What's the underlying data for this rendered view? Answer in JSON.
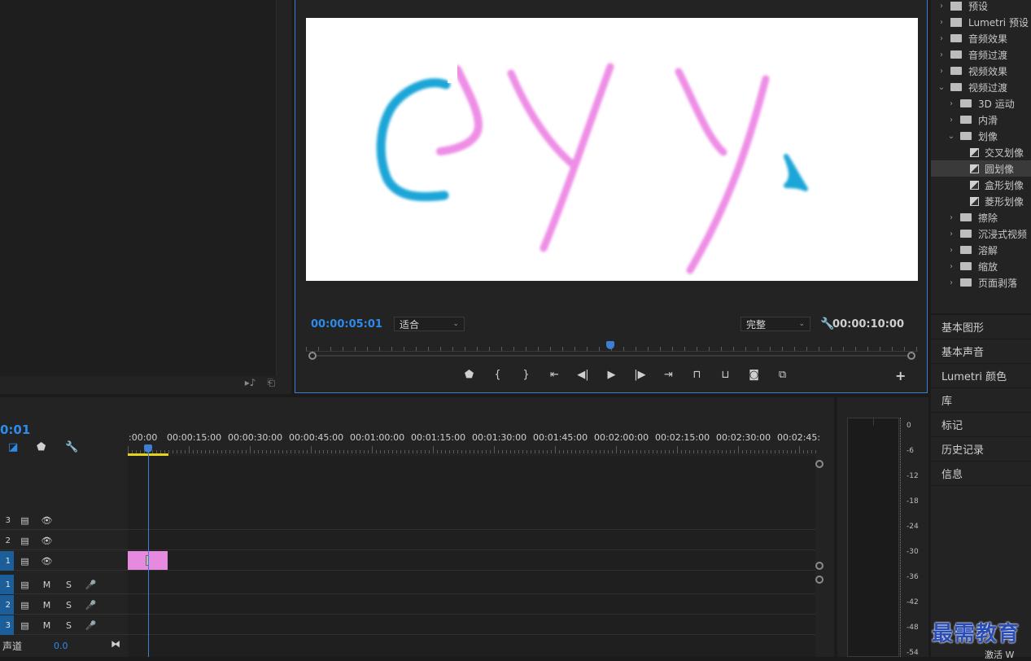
{
  "program": {
    "current_timecode": "00:00:05:01",
    "duration_timecode": "00:00:10:00",
    "fit_select": "适合",
    "quality_select": "完整"
  },
  "effects": {
    "items": [
      {
        "label": "预设",
        "depth": 0,
        "expanded": false,
        "icon": "preset-folder-icon"
      },
      {
        "label": "Lumetri 预设",
        "depth": 0,
        "expanded": false,
        "icon": "preset-folder-icon"
      },
      {
        "label": "音频效果",
        "depth": 0,
        "expanded": false,
        "icon": "folder-icon"
      },
      {
        "label": "音频过渡",
        "depth": 0,
        "expanded": false,
        "icon": "folder-icon"
      },
      {
        "label": "视频效果",
        "depth": 0,
        "expanded": false,
        "icon": "folder-icon"
      },
      {
        "label": "视频过渡",
        "depth": 0,
        "expanded": true,
        "icon": "folder-icon"
      },
      {
        "label": "3D 运动",
        "depth": 1,
        "expanded": false,
        "icon": "folder-icon"
      },
      {
        "label": "内滑",
        "depth": 1,
        "expanded": false,
        "icon": "folder-icon"
      },
      {
        "label": "划像",
        "depth": 1,
        "expanded": true,
        "icon": "folder-icon"
      },
      {
        "label": "交叉划像",
        "depth": 2,
        "icon": "transition-icon"
      },
      {
        "label": "圆划像",
        "depth": 2,
        "icon": "transition-icon",
        "selected": true
      },
      {
        "label": "盒形划像",
        "depth": 2,
        "icon": "transition-icon"
      },
      {
        "label": "菱形划像",
        "depth": 2,
        "icon": "transition-icon"
      },
      {
        "label": "擦除",
        "depth": 1,
        "expanded": false,
        "icon": "folder-icon"
      },
      {
        "label": "沉浸式视频",
        "depth": 1,
        "expanded": false,
        "icon": "folder-icon"
      },
      {
        "label": "溶解",
        "depth": 1,
        "expanded": false,
        "icon": "folder-icon"
      },
      {
        "label": "缩放",
        "depth": 1,
        "expanded": false,
        "icon": "folder-icon"
      },
      {
        "label": "页面剥落",
        "depth": 1,
        "expanded": false,
        "icon": "folder-icon"
      }
    ]
  },
  "side_tabs": {
    "basic_graphics": "基本图形",
    "basic_sound": "基本声音",
    "lumetri_color": "Lumetri 颜色",
    "library": "库",
    "markers": "标记",
    "history": "历史记录",
    "info": "信息"
  },
  "timeline": {
    "timecode": "0:01",
    "ruler_labels": [
      ":00:00",
      "00:00:15:00",
      "00:00:30:00",
      "00:00:45:00",
      "00:01:00:00",
      "00:01:15:00",
      "00:01:30:00",
      "00:01:45:00",
      "00:02:00:00",
      "00:02:15:00",
      "00:02:30:00",
      "00:02:45:"
    ],
    "video_tracks": [
      "3",
      "2",
      "1"
    ],
    "audio_tracks": [
      "1",
      "2",
      "3"
    ],
    "mute_label": "M",
    "solo_label": "S",
    "master_label": "声道",
    "master_value": "0.0",
    "clip_color": "#e68ae0"
  },
  "meter": {
    "db_labels": [
      "0",
      "-6",
      "-12",
      "-18",
      "-24",
      "-30",
      "-36",
      "-42",
      "-48",
      "-54"
    ]
  },
  "watermark": {
    "text": "最需教育",
    "sub": "激活 W"
  },
  "colors": {
    "accent_blue": "#2d8ceb",
    "panel_bg": "#232323",
    "work_area": "#e5d31b",
    "stroke_pink": "#ee8ee6",
    "stroke_blue": "#1aa6d8"
  }
}
